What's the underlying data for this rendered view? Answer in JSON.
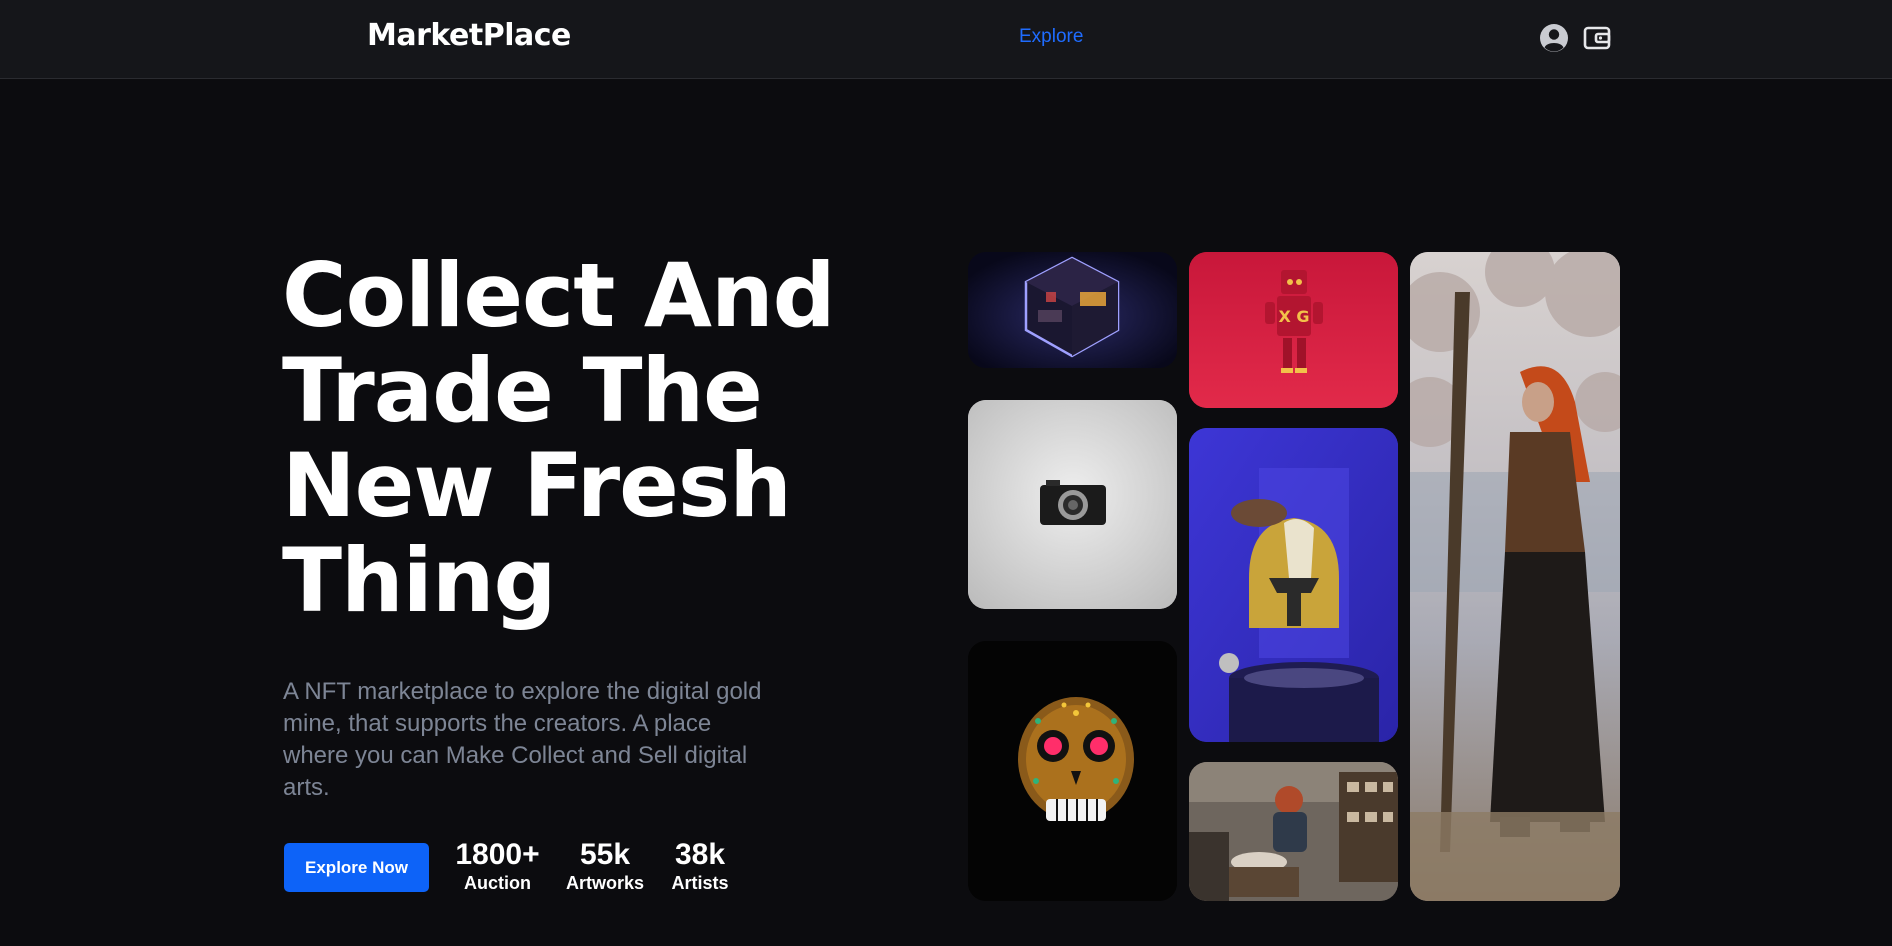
{
  "header": {
    "brand": "MarketPlace",
    "nav_link": "Explore",
    "icons": [
      "user-circle-icon",
      "wallet-icon"
    ]
  },
  "hero": {
    "title_lines": [
      "Collect And",
      "Trade The",
      "New Fresh",
      "Thing"
    ],
    "description": "A NFT marketplace to explore the digital gold mine, that supports the creators. A place where you can Make Collect and Sell digital arts.",
    "cta_label": "Explore Now",
    "stats": [
      {
        "value": "1800+",
        "label": "Auction"
      },
      {
        "value": "55k",
        "label": "Artworks"
      },
      {
        "value": "38k",
        "label": "Artists"
      }
    ]
  },
  "colors": {
    "background": "#0c0c0f",
    "header": "#15161a",
    "accent": "#0d63f8",
    "link": "#1f6cff",
    "muted_text": "#7d8595"
  }
}
